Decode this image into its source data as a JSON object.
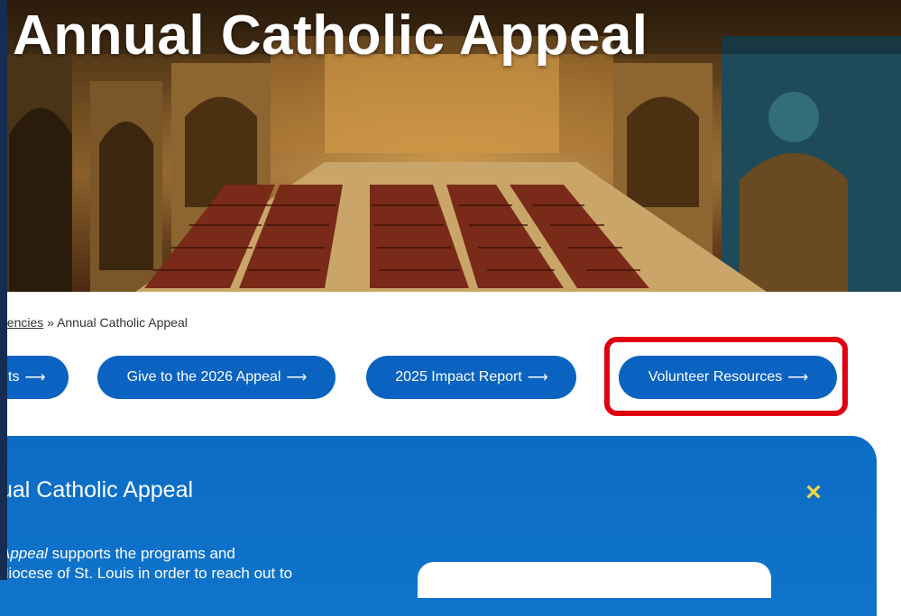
{
  "hero": {
    "title": "Annual Catholic Appeal"
  },
  "breadcrumb": {
    "link": "gencies",
    "separator": " » ",
    "current": "Annual Catholic Appeal"
  },
  "buttons": [
    {
      "label": "ults",
      "arrow": "⟶"
    },
    {
      "label": "Give to the 2026 Appeal",
      "arrow": "⟶"
    },
    {
      "label": "2025 Impact Report",
      "arrow": "⟶"
    },
    {
      "label": "Volunteer Resources",
      "arrow": "⟶"
    }
  ],
  "panel": {
    "title": "ual Catholic Appeal",
    "close_icon": "×",
    "text_italic": "Appeal",
    "text_line1": " supports the programs and",
    "text_line2": "diocese of St. Louis in order to reach out to"
  },
  "colors": {
    "button": "#0a63c0",
    "highlight": "#e00012",
    "panel": "#0c6cc4",
    "close": "#f7d443"
  }
}
